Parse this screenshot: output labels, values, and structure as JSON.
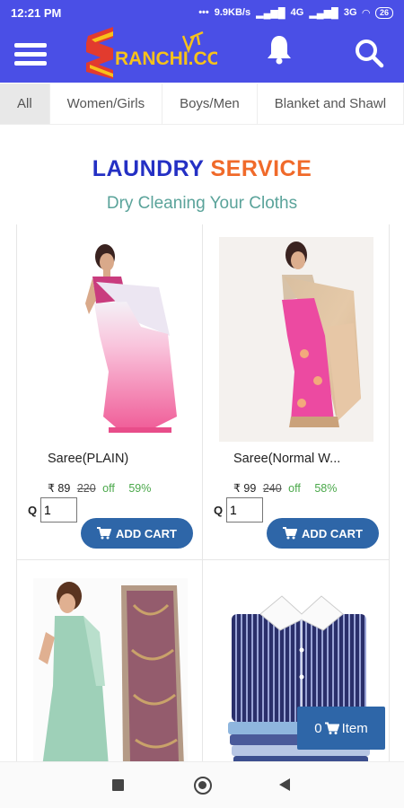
{
  "status_bar": {
    "time": "12:21 PM",
    "network": "9.9KB/s",
    "signal1": "4G",
    "signal2": "3G",
    "battery": "26"
  },
  "app_bar": {
    "logo_text": "RANCHI.COM",
    "icons": [
      "menu-icon",
      "bell-icon",
      "search-icon"
    ],
    "color": "#4a4fe6"
  },
  "tabs": [
    {
      "label": "All",
      "active": true
    },
    {
      "label": "Women/Girls",
      "active": false
    },
    {
      "label": "Boys/Men",
      "active": false
    },
    {
      "label": "Blanket and Shawl",
      "active": false
    }
  ],
  "section": {
    "title_part1": "LAUNDRY",
    "title_part2": "SERVICE",
    "subtitle": "Dry Cleaning Your Cloths"
  },
  "products": [
    {
      "name": "Saree(PLAIN)",
      "price": "₹ 89",
      "mrp": "220",
      "off": "off",
      "percent": "59%",
      "qty_label": "Q",
      "qty": "1",
      "button": "ADD CART"
    },
    {
      "name": "Saree(Normal W...",
      "price": "₹ 99",
      "mrp": "240",
      "off": "off",
      "percent": "58%",
      "qty_label": "Q",
      "qty": "1",
      "button": "ADD CART"
    }
  ],
  "cart_button": {
    "count": "0",
    "label": "Item"
  },
  "colors": {
    "accent": "#2e66a8",
    "title_blue": "#2430c4",
    "title_orange": "#f06a2a",
    "subtitle": "#5aa39a",
    "discount": "#4aa84a"
  }
}
